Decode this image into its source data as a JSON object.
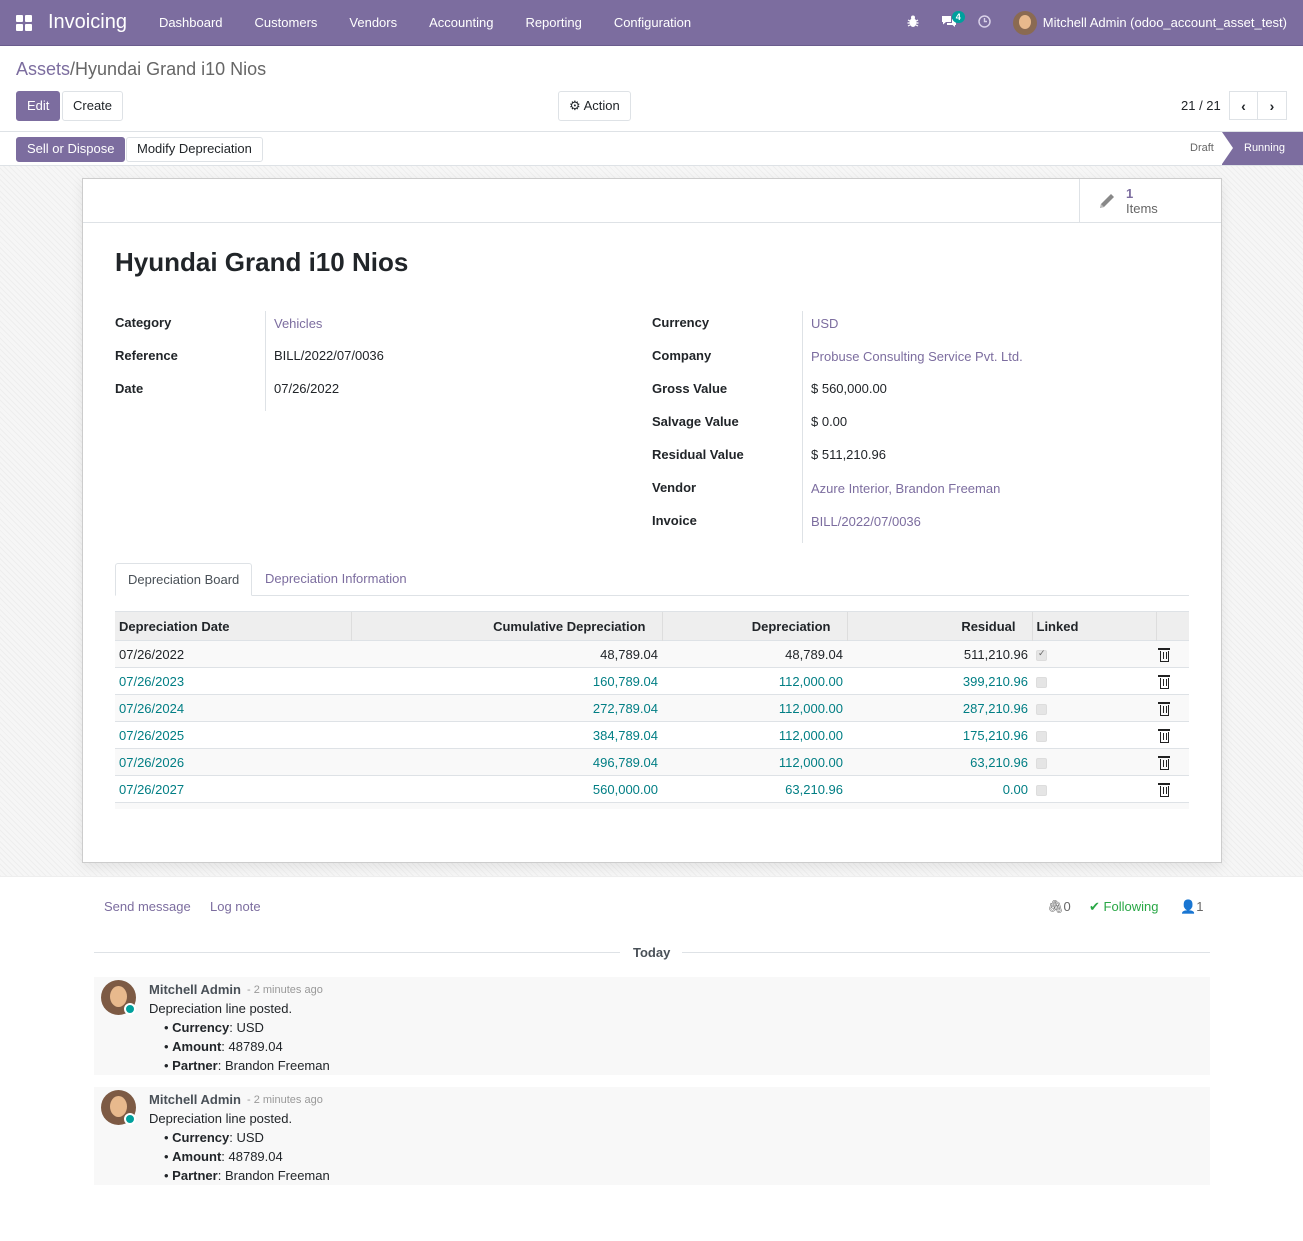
{
  "app": {
    "brand": "Invoicing",
    "menu": [
      "Dashboard",
      "Customers",
      "Vendors",
      "Accounting",
      "Reporting",
      "Configuration"
    ],
    "messages_badge": "4",
    "user": "Mitchell Admin (odoo_account_asset_test)"
  },
  "colors": {
    "primary": "#7c6d9f",
    "teal": "#017e84",
    "green": "#28a745"
  },
  "breadcrumb": {
    "parent": "Assets",
    "separator": "/",
    "current": "Hyundai Grand i10 Nios"
  },
  "controls": {
    "edit": "Edit",
    "create": "Create",
    "action": "Action",
    "pager": "21 / 21"
  },
  "statusbar": {
    "sell": "Sell or Dispose",
    "modify": "Modify Depreciation",
    "stages": [
      "Draft",
      "Running"
    ],
    "active_stage": "Running"
  },
  "smart_button": {
    "count": "1",
    "label": "Items"
  },
  "asset": {
    "title": "Hyundai Grand i10 Nios",
    "left_fields": [
      {
        "label": "Category",
        "value": "Vehicles"
      },
      {
        "label": "Reference",
        "value": "BILL/2022/07/0036"
      },
      {
        "label": "Date",
        "value": "07/26/2022"
      }
    ],
    "right_fields": [
      {
        "label": "Currency",
        "value": "USD"
      },
      {
        "label": "Company",
        "value": "Probuse Consulting Service Pvt. Ltd."
      },
      {
        "label": "Gross Value",
        "value": "$ 560,000.00"
      },
      {
        "label": "Salvage Value",
        "value": "$ 0.00"
      },
      {
        "label": "Residual Value",
        "value": "$ 511,210.96"
      },
      {
        "label": "Vendor",
        "value": "Azure Interior, Brandon Freeman"
      },
      {
        "label": "Invoice",
        "value": "BILL/2022/07/0036"
      }
    ]
  },
  "tabs": [
    "Depreciation Board",
    "Depreciation Information"
  ],
  "table": {
    "headers": [
      "Depreciation Date",
      "Cumulative Depreciation",
      "Depreciation",
      "Residual",
      "Linked"
    ],
    "rows": [
      {
        "date": "07/26/2022",
        "cumulative": "48,789.04",
        "depreciation": "48,789.04",
        "residual": "511,210.96",
        "linked": true
      },
      {
        "date": "07/26/2023",
        "cumulative": "160,789.04",
        "depreciation": "112,000.00",
        "residual": "399,210.96",
        "linked": false
      },
      {
        "date": "07/26/2024",
        "cumulative": "272,789.04",
        "depreciation": "112,000.00",
        "residual": "287,210.96",
        "linked": false
      },
      {
        "date": "07/26/2025",
        "cumulative": "384,789.04",
        "depreciation": "112,000.00",
        "residual": "175,210.96",
        "linked": false
      },
      {
        "date": "07/26/2026",
        "cumulative": "496,789.04",
        "depreciation": "112,000.00",
        "residual": "63,210.96",
        "linked": false
      },
      {
        "date": "07/26/2027",
        "cumulative": "560,000.00",
        "depreciation": "63,210.96",
        "residual": "0.00",
        "linked": false
      }
    ]
  },
  "chatter": {
    "send_message": "Send message",
    "log_note": "Log note",
    "attachments": "0",
    "following": "Following",
    "followers": "1",
    "today": "Today",
    "messages": [
      {
        "author": "Mitchell Admin",
        "time": "- 2 minutes ago",
        "body": "Depreciation line posted.",
        "currency_label": "Currency",
        "currency": "USD",
        "amount_label": "Amount",
        "amount": "48789.04",
        "partner_label": "Partner",
        "partner": "Brandon Freeman"
      },
      {
        "author": "Mitchell Admin",
        "time": "- 2 minutes ago",
        "body": "Depreciation line posted.",
        "currency_label": "Currency",
        "currency": "USD",
        "amount_label": "Amount",
        "amount": "48789.04",
        "partner_label": "Partner",
        "partner": "Brandon Freeman"
      }
    ]
  }
}
